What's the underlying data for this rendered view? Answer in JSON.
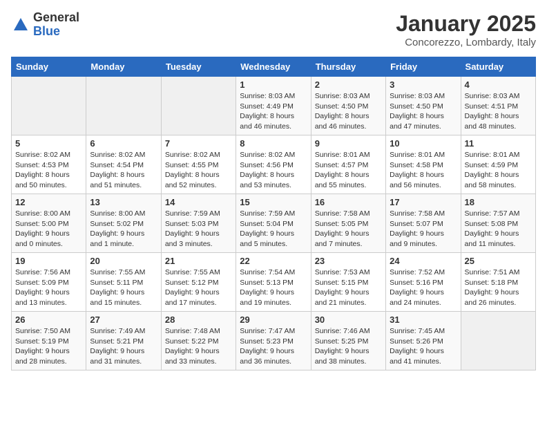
{
  "logo": {
    "general": "General",
    "blue": "Blue"
  },
  "header": {
    "title": "January 2025",
    "subtitle": "Concorezzo, Lombardy, Italy"
  },
  "weekdays": [
    "Sunday",
    "Monday",
    "Tuesday",
    "Wednesday",
    "Thursday",
    "Friday",
    "Saturday"
  ],
  "weeks": [
    [
      null,
      null,
      null,
      {
        "day": 1,
        "sunrise": "8:03 AM",
        "sunset": "4:49 PM",
        "daylight": "8 hours and 46 minutes."
      },
      {
        "day": 2,
        "sunrise": "8:03 AM",
        "sunset": "4:50 PM",
        "daylight": "8 hours and 46 minutes."
      },
      {
        "day": 3,
        "sunrise": "8:03 AM",
        "sunset": "4:50 PM",
        "daylight": "8 hours and 47 minutes."
      },
      {
        "day": 4,
        "sunrise": "8:03 AM",
        "sunset": "4:51 PM",
        "daylight": "8 hours and 48 minutes."
      }
    ],
    [
      {
        "day": 5,
        "sunrise": "8:02 AM",
        "sunset": "4:53 PM",
        "daylight": "8 hours and 50 minutes."
      },
      {
        "day": 6,
        "sunrise": "8:02 AM",
        "sunset": "4:54 PM",
        "daylight": "8 hours and 51 minutes."
      },
      {
        "day": 7,
        "sunrise": "8:02 AM",
        "sunset": "4:55 PM",
        "daylight": "8 hours and 52 minutes."
      },
      {
        "day": 8,
        "sunrise": "8:02 AM",
        "sunset": "4:56 PM",
        "daylight": "8 hours and 53 minutes."
      },
      {
        "day": 9,
        "sunrise": "8:01 AM",
        "sunset": "4:57 PM",
        "daylight": "8 hours and 55 minutes."
      },
      {
        "day": 10,
        "sunrise": "8:01 AM",
        "sunset": "4:58 PM",
        "daylight": "8 hours and 56 minutes."
      },
      {
        "day": 11,
        "sunrise": "8:01 AM",
        "sunset": "4:59 PM",
        "daylight": "8 hours and 58 minutes."
      }
    ],
    [
      {
        "day": 12,
        "sunrise": "8:00 AM",
        "sunset": "5:00 PM",
        "daylight": "9 hours and 0 minutes."
      },
      {
        "day": 13,
        "sunrise": "8:00 AM",
        "sunset": "5:02 PM",
        "daylight": "9 hours and 1 minute."
      },
      {
        "day": 14,
        "sunrise": "7:59 AM",
        "sunset": "5:03 PM",
        "daylight": "9 hours and 3 minutes."
      },
      {
        "day": 15,
        "sunrise": "7:59 AM",
        "sunset": "5:04 PM",
        "daylight": "9 hours and 5 minutes."
      },
      {
        "day": 16,
        "sunrise": "7:58 AM",
        "sunset": "5:05 PM",
        "daylight": "9 hours and 7 minutes."
      },
      {
        "day": 17,
        "sunrise": "7:58 AM",
        "sunset": "5:07 PM",
        "daylight": "9 hours and 9 minutes."
      },
      {
        "day": 18,
        "sunrise": "7:57 AM",
        "sunset": "5:08 PM",
        "daylight": "9 hours and 11 minutes."
      }
    ],
    [
      {
        "day": 19,
        "sunrise": "7:56 AM",
        "sunset": "5:09 PM",
        "daylight": "9 hours and 13 minutes."
      },
      {
        "day": 20,
        "sunrise": "7:55 AM",
        "sunset": "5:11 PM",
        "daylight": "9 hours and 15 minutes."
      },
      {
        "day": 21,
        "sunrise": "7:55 AM",
        "sunset": "5:12 PM",
        "daylight": "9 hours and 17 minutes."
      },
      {
        "day": 22,
        "sunrise": "7:54 AM",
        "sunset": "5:13 PM",
        "daylight": "9 hours and 19 minutes."
      },
      {
        "day": 23,
        "sunrise": "7:53 AM",
        "sunset": "5:15 PM",
        "daylight": "9 hours and 21 minutes."
      },
      {
        "day": 24,
        "sunrise": "7:52 AM",
        "sunset": "5:16 PM",
        "daylight": "9 hours and 24 minutes."
      },
      {
        "day": 25,
        "sunrise": "7:51 AM",
        "sunset": "5:18 PM",
        "daylight": "9 hours and 26 minutes."
      }
    ],
    [
      {
        "day": 26,
        "sunrise": "7:50 AM",
        "sunset": "5:19 PM",
        "daylight": "9 hours and 28 minutes."
      },
      {
        "day": 27,
        "sunrise": "7:49 AM",
        "sunset": "5:21 PM",
        "daylight": "9 hours and 31 minutes."
      },
      {
        "day": 28,
        "sunrise": "7:48 AM",
        "sunset": "5:22 PM",
        "daylight": "9 hours and 33 minutes."
      },
      {
        "day": 29,
        "sunrise": "7:47 AM",
        "sunset": "5:23 PM",
        "daylight": "9 hours and 36 minutes."
      },
      {
        "day": 30,
        "sunrise": "7:46 AM",
        "sunset": "5:25 PM",
        "daylight": "9 hours and 38 minutes."
      },
      {
        "day": 31,
        "sunrise": "7:45 AM",
        "sunset": "5:26 PM",
        "daylight": "9 hours and 41 minutes."
      },
      null
    ]
  ]
}
